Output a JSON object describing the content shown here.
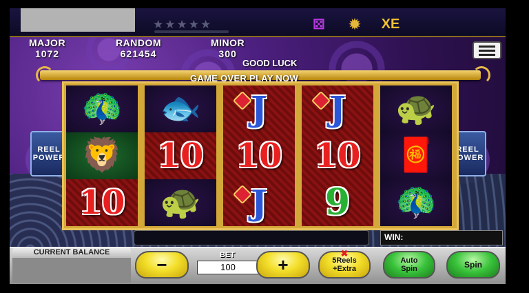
{
  "topbar": {
    "stars": "★★★★★",
    "icons": [
      {
        "name": "dice-icon",
        "glyph": "⚄",
        "color": "#b03ad8"
      },
      {
        "name": "prize-wheel-icon",
        "glyph": "✹",
        "color": "#e6b83a"
      },
      {
        "name": "coins-icon",
        "glyph": "XE",
        "color": "#f0c030"
      }
    ]
  },
  "jackpots": {
    "major": {
      "label": "MAJOR",
      "value": "1072"
    },
    "random": {
      "label": "RANDOM",
      "value": "621454"
    },
    "minor": {
      "label": "MINOR",
      "value": "300"
    }
  },
  "messages": {
    "good_luck": "GOOD LUCK",
    "game_over": "GAME OVER PLAY NOW"
  },
  "reels": [
    [
      {
        "kind": "pic",
        "glyph": "🦚",
        "name": "golden-phoenix-symbol",
        "bg": "dark"
      },
      {
        "kind": "pic",
        "glyph": "🦁",
        "name": "foo-dog-symbol",
        "bg": "green"
      },
      {
        "kind": "num",
        "text": "10",
        "name": "ten-symbol"
      }
    ],
    [
      {
        "kind": "pic",
        "glyph": "🐟",
        "name": "golden-koi-symbol",
        "bg": "dark"
      },
      {
        "kind": "num",
        "text": "10",
        "name": "ten-symbol"
      },
      {
        "kind": "pic",
        "glyph": "🐢",
        "name": "golden-turtle-symbol",
        "bg": "dark"
      }
    ],
    [
      {
        "kind": "j",
        "text": "J",
        "name": "jack-symbol"
      },
      {
        "kind": "num",
        "text": "10",
        "name": "ten-symbol"
      },
      {
        "kind": "j",
        "text": "J",
        "name": "jack-symbol"
      }
    ],
    [
      {
        "kind": "j",
        "text": "J",
        "name": "jack-symbol"
      },
      {
        "kind": "num",
        "text": "10",
        "name": "ten-symbol"
      },
      {
        "kind": "nine",
        "text": "9",
        "name": "nine-symbol"
      }
    ],
    [
      {
        "kind": "pic",
        "glyph": "🐢",
        "name": "golden-turtle-symbol",
        "bg": "dark"
      },
      {
        "kind": "pic",
        "glyph": "🧧",
        "name": "red-envelope-symbol",
        "bg": "dark"
      },
      {
        "kind": "pic",
        "glyph": "🦚",
        "name": "golden-phoenix-symbol",
        "bg": "dark"
      }
    ]
  ],
  "reel_power": {
    "line1": "REEL",
    "line2": "POWER"
  },
  "win_label": "WIN:",
  "controls": {
    "balance_label": "CURRENT BALANCE",
    "minus": "−",
    "bet_label": "BET",
    "bet_value": "100",
    "plus": "+",
    "five_reels_extra": "5Reels\n+Extra",
    "five_reels_mark": "✖",
    "auto_spin": "Auto\nSpin",
    "spin": "Spin"
  }
}
